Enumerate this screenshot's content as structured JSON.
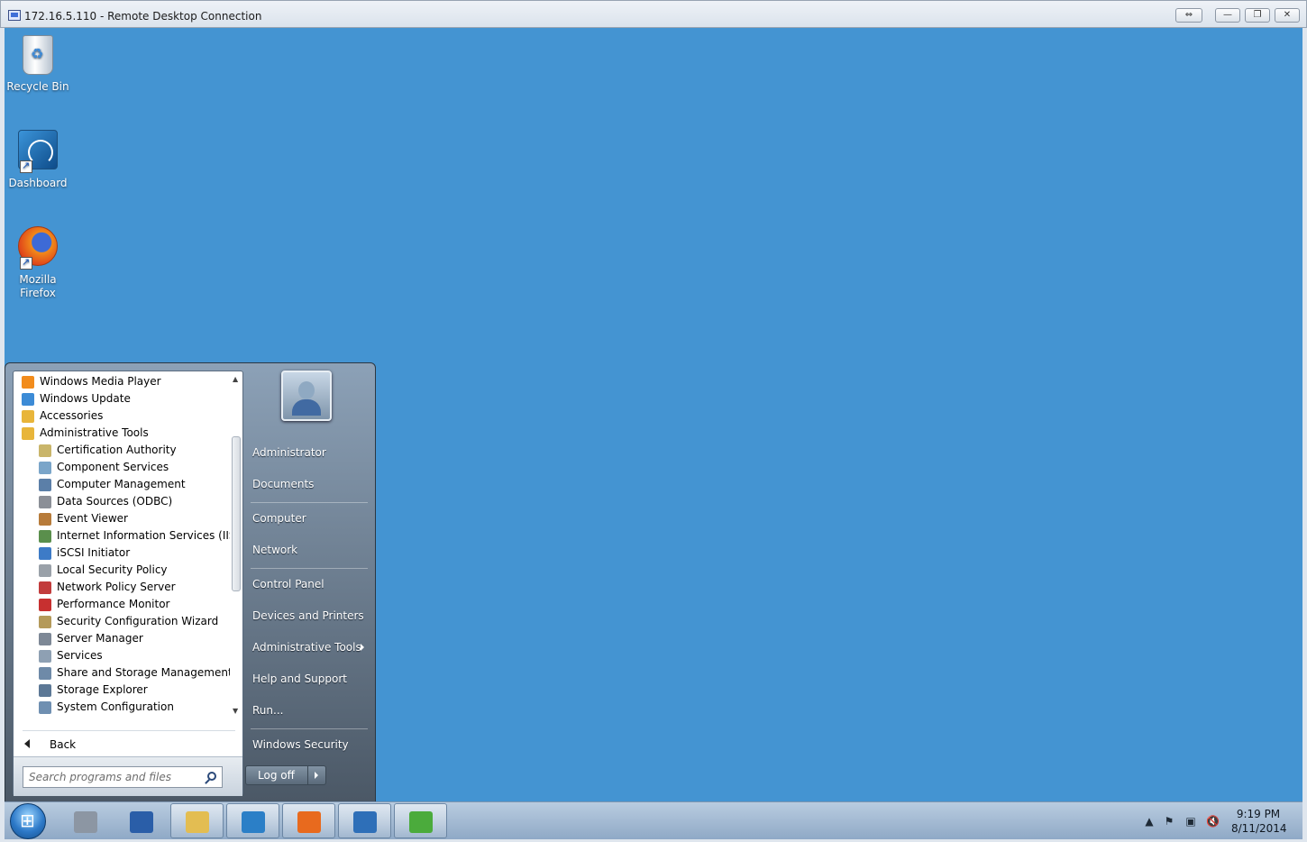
{
  "window": {
    "title": "172.16.5.110 - Remote Desktop Connection",
    "controls": {
      "restore_connection": "⇔",
      "minimize": "—",
      "maximize": "❐",
      "close": "✕"
    }
  },
  "desktop": {
    "background_color": "#4494d2",
    "icons": [
      {
        "label": "Recycle Bin",
        "icon": "recycle-bin-icon"
      },
      {
        "label": "Dashboard",
        "icon": "dashboard-icon"
      },
      {
        "label": "Mozilla Firefox",
        "icon": "firefox-icon"
      }
    ]
  },
  "start_menu": {
    "programs": [
      {
        "label": "Windows Media Player",
        "icon": "windows-media-player-icon",
        "level": 0
      },
      {
        "label": "Windows Update",
        "icon": "windows-update-icon",
        "level": 0
      },
      {
        "label": "Accessories",
        "icon": "folder-icon",
        "level": 0
      },
      {
        "label": "Administrative Tools",
        "icon": "folder-icon",
        "level": 0
      },
      {
        "label": "Certification Authority",
        "icon": "certificate-icon",
        "level": 1
      },
      {
        "label": "Component Services",
        "icon": "component-services-icon",
        "level": 1
      },
      {
        "label": "Computer Management",
        "icon": "computer-management-icon",
        "level": 1
      },
      {
        "label": "Data Sources (ODBC)",
        "icon": "data-sources-icon",
        "level": 1
      },
      {
        "label": "Event Viewer",
        "icon": "event-viewer-icon",
        "level": 1
      },
      {
        "label": "Internet Information Services (IIS) M",
        "icon": "iis-icon",
        "level": 1
      },
      {
        "label": "iSCSI Initiator",
        "icon": "iscsi-icon",
        "level": 1
      },
      {
        "label": "Local Security Policy",
        "icon": "security-policy-icon",
        "level": 1
      },
      {
        "label": "Network Policy Server",
        "icon": "network-policy-icon",
        "level": 1
      },
      {
        "label": "Performance Monitor",
        "icon": "performance-monitor-icon",
        "level": 1
      },
      {
        "label": "Security Configuration Wizard",
        "icon": "security-wizard-icon",
        "level": 1
      },
      {
        "label": "Server Manager",
        "icon": "server-manager-icon",
        "level": 1
      },
      {
        "label": "Services",
        "icon": "services-icon",
        "level": 1
      },
      {
        "label": "Share and Storage Management",
        "icon": "storage-management-icon",
        "level": 1
      },
      {
        "label": "Storage Explorer",
        "icon": "storage-explorer-icon",
        "level": 1
      },
      {
        "label": "System Configuration",
        "icon": "system-configuration-icon",
        "level": 1
      }
    ],
    "back_label": "Back",
    "search_placeholder": "Search programs and files",
    "right_items": [
      {
        "label": "Administrator"
      },
      {
        "label": "Documents"
      },
      {
        "label": "Computer"
      },
      {
        "label": "Network"
      },
      {
        "label": "Control Panel"
      },
      {
        "label": "Devices and Printers"
      },
      {
        "label": "Administrative Tools",
        "has_submenu": true
      },
      {
        "label": "Help and Support"
      },
      {
        "label": "Run..."
      },
      {
        "label": "Windows Security"
      }
    ],
    "logoff_label": "Log off"
  },
  "taskbar": {
    "buttons": [
      {
        "icon": "server-manager-icon",
        "active": false
      },
      {
        "icon": "powershell-icon",
        "active": false
      },
      {
        "icon": "windows-explorer-icon",
        "active": true
      },
      {
        "icon": "dashboard-icon",
        "active": true
      },
      {
        "icon": "firefox-icon",
        "active": true
      },
      {
        "icon": "app-building-icon",
        "active": true
      },
      {
        "icon": "sync-arrows-icon",
        "active": true
      }
    ],
    "tray_icons": [
      "show-hidden-icons-icon",
      "action-center-flag-icon",
      "network-icon",
      "volume-muted-icon"
    ],
    "time": "9:19 PM",
    "date": "8/11/2014"
  }
}
